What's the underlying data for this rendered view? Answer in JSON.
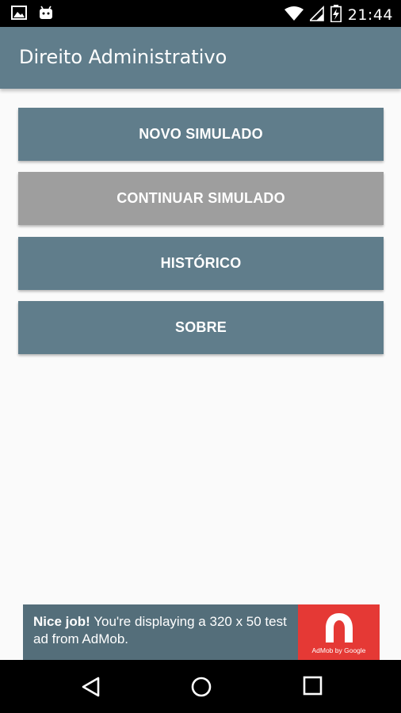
{
  "status_bar": {
    "time": "21:44",
    "left_icons": [
      "image-icon",
      "android-icon"
    ],
    "right_icons": [
      "wifi-icon",
      "signal-icon",
      "battery-charging-icon"
    ]
  },
  "app_bar": {
    "title": "Direito Administrativo",
    "color": "#607D8B"
  },
  "menu": {
    "new_quiz": "NOVO SIMULADO",
    "continue_quiz": "CONTINUAR SIMULADO",
    "history": "HISTÓRICO",
    "about": "SOBRE",
    "colors": {
      "enabled": "#607D8B",
      "disabled": "#9E9E9E"
    }
  },
  "ad": {
    "headline": "Nice job!",
    "body": " You're displaying a 320 x 50 test ad from AdMob.",
    "brand": "AdMob by Google",
    "brand_color": "#E53935"
  },
  "nav_bar": {
    "icons": [
      "back-icon",
      "home-icon",
      "recents-icon"
    ]
  }
}
